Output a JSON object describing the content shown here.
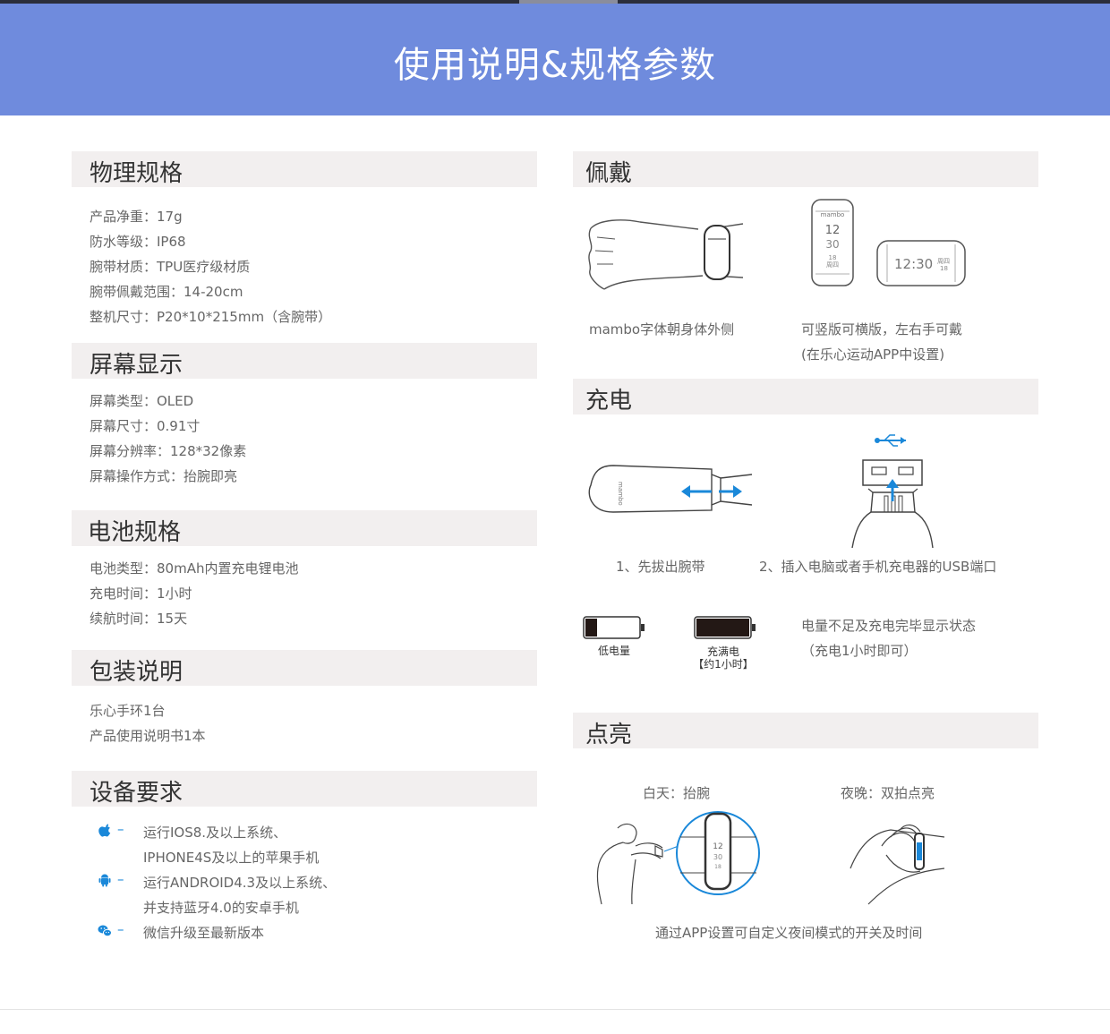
{
  "banner": {
    "title": "使用说明&规格参数"
  },
  "physical": {
    "title": "物理规格",
    "items": [
      "产品净重：17g",
      "防水等级：IP68",
      "腕带材质：TPU医疗级材质",
      "腕带佩戴范围：14-20cm",
      "整机尺寸：P20*10*215mm（含腕带）"
    ]
  },
  "screen": {
    "title": "屏幕显示",
    "items": [
      "屏幕类型：OLED",
      "屏幕尺寸：0.91寸",
      "屏幕分辨率：128*32像素",
      "屏幕操作方式：抬腕即亮"
    ]
  },
  "battery": {
    "title": "电池规格",
    "items": [
      "电池类型：80mAh内置充电锂电池",
      "充电时间：1小时",
      "续航时间：15天"
    ]
  },
  "package": {
    "title": "包装说明",
    "items": [
      "乐心手环1台",
      "产品使用说明书1本"
    ]
  },
  "requirements": {
    "title": "设备要求",
    "dash": "–",
    "lines": [
      "运行IOS8.及以上系统、",
      "IPHONE4S及以上的苹果手机",
      "运行ANDROID4.3及以上系统、",
      "并支持蓝牙4.0的安卓手机",
      "微信升级至最新版本"
    ],
    "icons": [
      "apple-icon",
      "android-icon",
      "wechat-icon"
    ],
    "accent": "#1a88d9"
  },
  "wear": {
    "title": "佩戴",
    "caption_left": "mambo字体朝身体外侧",
    "caption_right_1": "可竖版可横版，左右手可戴",
    "caption_right_2": "(在乐心运动APP中设置)",
    "band_logo": "mambo",
    "vertical_screen": {
      "hour": "12",
      "minute": "30",
      "date": "18",
      "weekday": "周四"
    },
    "horizontal_screen": {
      "time": "12:30",
      "weekday": "周四",
      "date": "18"
    }
  },
  "charge": {
    "title": "充电",
    "step1": "1、先拔出腕带",
    "step2": "2、插入电脑或者手机充电器的USB端口",
    "battery_low": "低电量",
    "battery_full_1": "充满电",
    "battery_full_2": "【约1小时】",
    "status_1": "电量不足及充电完毕显示状态",
    "status_2": "（充电1小时即可）",
    "usb_symbol": "⭠⊸⭢"
  },
  "light": {
    "title": "点亮",
    "day": "白天：抬腕",
    "night": "夜晚：双拍点亮",
    "note": "通过APP设置可自定义夜间模式的开关及时间",
    "zoom_screen": {
      "hour": "12",
      "minute": "30",
      "date": "18"
    }
  },
  "colors": {
    "banner": "#6f8bdd",
    "section_bg": "#f2efef",
    "arrow": "#1a88d9"
  }
}
